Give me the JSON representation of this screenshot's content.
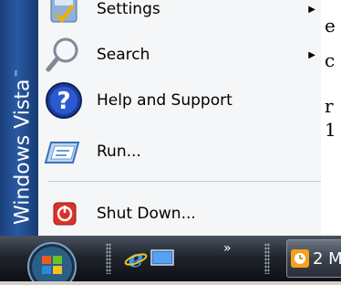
{
  "background_window": {
    "fragments": [
      "e",
      "c",
      "r",
      "1"
    ]
  },
  "start_menu": {
    "brand": "Windows Vista",
    "brand_tm": "™",
    "items": [
      {
        "label": "Settings",
        "icon": "settings-icon",
        "has_submenu": true
      },
      {
        "label": "Search",
        "icon": "search-icon",
        "has_submenu": true
      },
      {
        "label": "Help and Support",
        "icon": "help-icon",
        "has_submenu": false
      },
      {
        "label": "Run...",
        "icon": "run-icon",
        "has_submenu": false
      },
      {
        "label": "Shut Down...",
        "icon": "shutdown-icon",
        "has_submenu": false
      }
    ],
    "submenu_arrow": "▶"
  },
  "taskbar": {
    "quick_launch_overflow": "»",
    "task_button_label": "2 M",
    "colors": {
      "start_menu_bg": "#f5f6f7",
      "brand_blue": "#1f4c8f",
      "taskbar_dark": "#1a1e25"
    }
  }
}
